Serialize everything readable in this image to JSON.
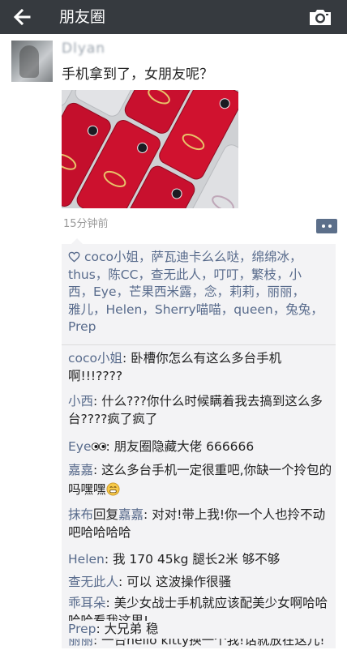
{
  "header": {
    "title": "朋友圈",
    "bg_color": "#363a3f"
  },
  "post": {
    "username": "Dlyan",
    "text": "手机拿到了，女朋友呢？",
    "timestamp": "15分钟前",
    "likes": {
      "names": [
        "coco小姐",
        "萨瓦迪卡么么哒",
        "绵绵冰",
        "thus",
        "陈CC",
        "查无此人",
        "叮叮",
        "繁枝",
        "小西",
        "Eye",
        "芒果西米露",
        "念",
        "莉莉",
        "丽丽",
        "雅儿",
        "Helen",
        "Sherry喵喵",
        "queen",
        "兔兔",
        "Prep"
      ],
      "line1": "coco小姐，萨瓦迪卡么么哒，绵绵冰，",
      "line2": "thus，陈CC，查无此人，叮叮，繁枝，小",
      "line3": "西，Eye，芒果西米露，念，莉莉，丽丽，",
      "line4": "雅儿，Helen，Sherry喵喵，queen，兔兔，",
      "line5": "Prep"
    },
    "comments": [
      {
        "name": "coco小姐",
        "text": ": 卧槽你怎么有这么多台手机啊!!!????"
      },
      {
        "name": "小西",
        "text": ": 什么???你什么时候瞒着我去搞到这么多台????疯了疯了"
      },
      {
        "name": "Eye",
        "emoji": "eyes-emoji",
        "text": ": 朋友圈隐藏大佬  666666"
      },
      {
        "name": "嘉嘉",
        "text": ": 这么多台手机一定很重吧,你缺一个拎包的吗嘿嘿",
        "emoji": "grin-emoji"
      },
      {
        "name": "抹布",
        "reply_word": "回复",
        "reply_to": "嘉嘉",
        "text": ": 对对!带上我!你一个人也拎不动吧哈哈哈哈"
      },
      {
        "name": "Helen",
        "text": ": 我  170  45kg  腿长2米  够不够"
      },
      {
        "name": "查无此人",
        "text": ": 可以  这波操作很骚"
      },
      {
        "name": "乖耳朵",
        "text": ": 美少女战士手机就应该配美少女啊哈哈哈哈看我这里!"
      },
      {
        "name": "丽丽",
        "text": ": 一台hello kitty换一个我!话就放在这儿!"
      },
      {
        "name": "Prep",
        "text": ": 大兄弟  稳"
      }
    ]
  },
  "colors": {
    "name_link": "#586b8c",
    "comment_area": "#f3f3f5",
    "phone_red": "#c8102e",
    "phone_silver": "#d9dadd"
  },
  "icons": [
    "back-arrow-icon",
    "camera-icon",
    "heart-icon",
    "comment-icon",
    "eyes-emoji",
    "grin-emoji"
  ]
}
